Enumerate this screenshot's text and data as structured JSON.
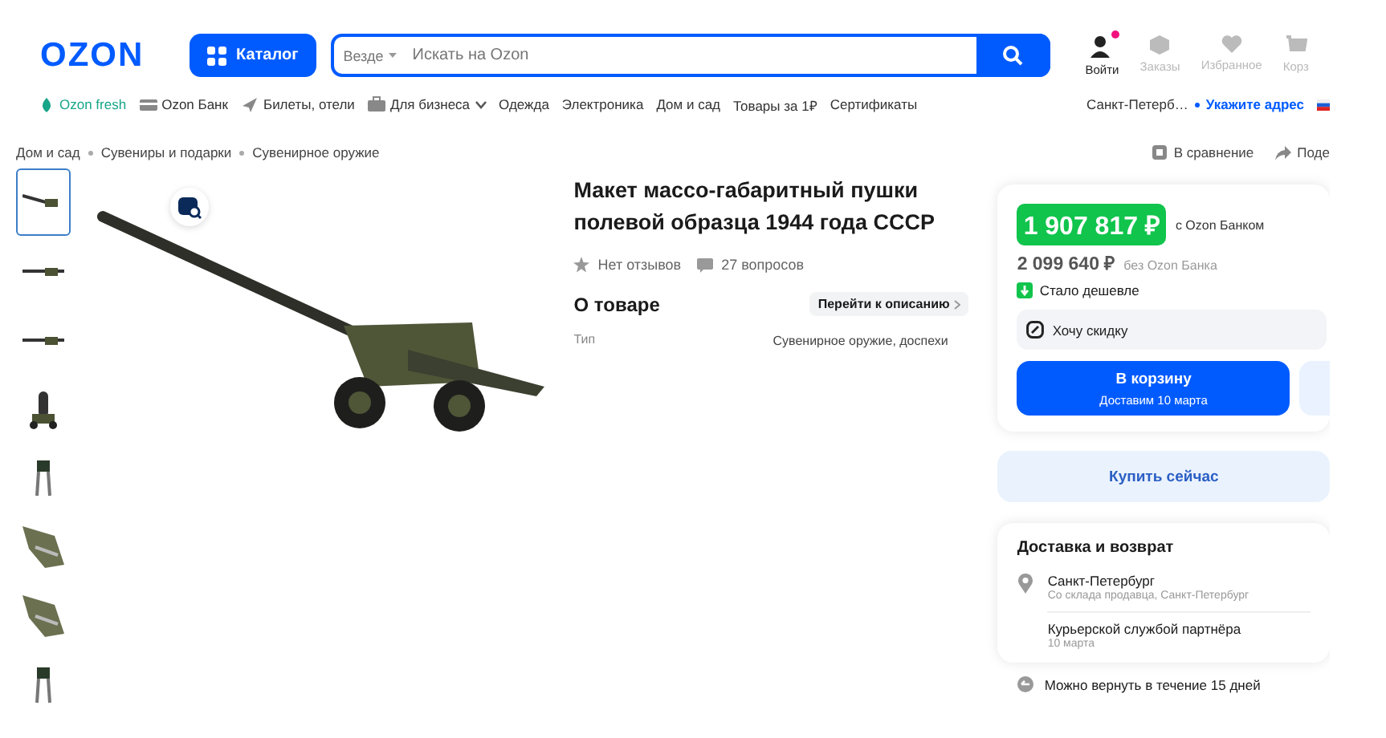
{
  "header": {
    "logo": "OZON",
    "catalog_button": "Каталог",
    "search": {
      "scope": "Везде",
      "placeholder": "Искать на Ozon"
    },
    "actions": [
      {
        "label": "Войти",
        "notification": true,
        "dimmed": false
      },
      {
        "label": "Заказы",
        "notification": false,
        "dimmed": true
      },
      {
        "label": "Избранное",
        "notification": false,
        "dimmed": true
      },
      {
        "label": "Корз",
        "notification": false,
        "dimmed": true
      }
    ]
  },
  "nav": {
    "items": [
      {
        "label": "Ozon fresh",
        "kind": "fresh"
      },
      {
        "label": "Ozon Банк",
        "kind": "bank"
      },
      {
        "label": "Билеты, отели",
        "kind": "travel"
      },
      {
        "label": "Для бизнеса",
        "kind": "business"
      },
      {
        "label": "Одежда",
        "kind": "plain"
      },
      {
        "label": "Электроника",
        "kind": "plain"
      },
      {
        "label": "Дом и сад",
        "kind": "plain"
      },
      {
        "label": "Товары за 1₽",
        "kind": "plain"
      },
      {
        "label": "Сертификаты",
        "kind": "plain"
      }
    ],
    "city": "Санкт-Петерб…",
    "address_link": "Укажите адрес"
  },
  "breadcrumbs": [
    "Дом и сад",
    "Сувениры и подарки",
    "Сувенирное оружие"
  ],
  "page_actions": [
    "В сравнение",
    "Поде"
  ],
  "gallery": {
    "thumbnails": [
      {
        "selected": true
      },
      {
        "selected": false
      },
      {
        "selected": false
      },
      {
        "selected": false
      },
      {
        "selected": false
      },
      {
        "selected": false
      },
      {
        "selected": false
      },
      {
        "selected": false
      }
    ]
  },
  "product": {
    "title": "Макет массо-габаритный пушки полевой образца 1944 года СССР",
    "reviews": "Нет отзывов",
    "questions": "27 вопросов",
    "about_title": "О товаре",
    "about_link": "Перейти к описанию",
    "specs": [
      {
        "name": "Тип",
        "value": "Сувенирное оружие, доспехи"
      }
    ]
  },
  "buy_panel": {
    "bank_price": "1 907 817 ₽",
    "bank_note": "с Ozon Банком",
    "price": "2 099 640 ₽",
    "price_note": "без Ozon Банка",
    "cheaper": "Стало дешевле",
    "discount": "Хочу скидку",
    "cart_button": "В корзину",
    "cart_delivery": "Доставим 10 марта",
    "buy_now": "Купить сейчас"
  },
  "delivery": {
    "title": "Доставка и возврат",
    "city": "Санкт-Петербург",
    "city_note": "Со склада продавца, Санкт-Петербург",
    "courier": "Курьерской службой партнёра",
    "courier_date": "10 марта",
    "return": "Можно вернуть в течение 15 дней"
  }
}
